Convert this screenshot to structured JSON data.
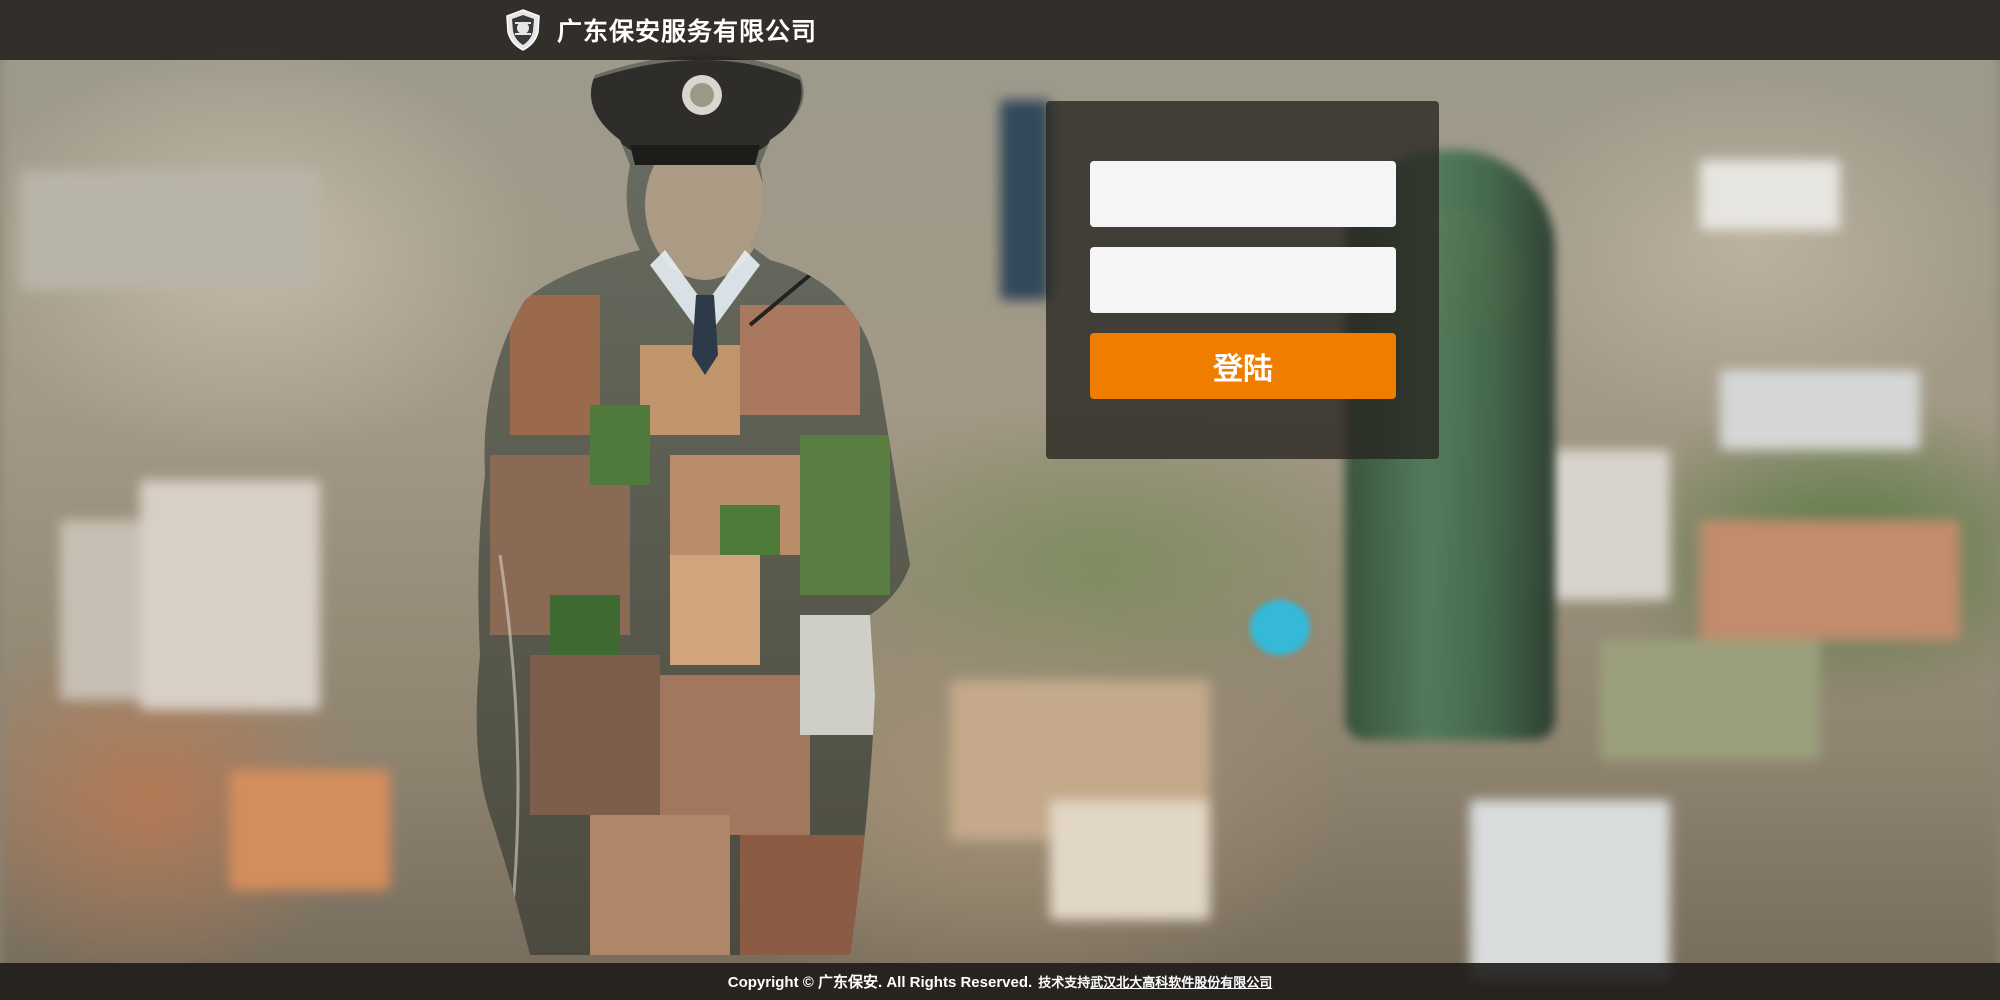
{
  "header": {
    "logo_icon": "security-badge-icon",
    "title": "广东保安服务有限公司"
  },
  "login": {
    "username_value": "",
    "password_value": "",
    "submit_label": "登陆",
    "accent_color": "#ef7d00"
  },
  "footer": {
    "copyright": "Copyright © 广东保安. All Rights Reserved.",
    "support_prefix": "技术支持",
    "support_link": "武汉北大高科软件股份有限公司"
  },
  "background": {
    "description_icon": "city-aerial-background",
    "overlay_icon": "security-guard-silhouette"
  }
}
